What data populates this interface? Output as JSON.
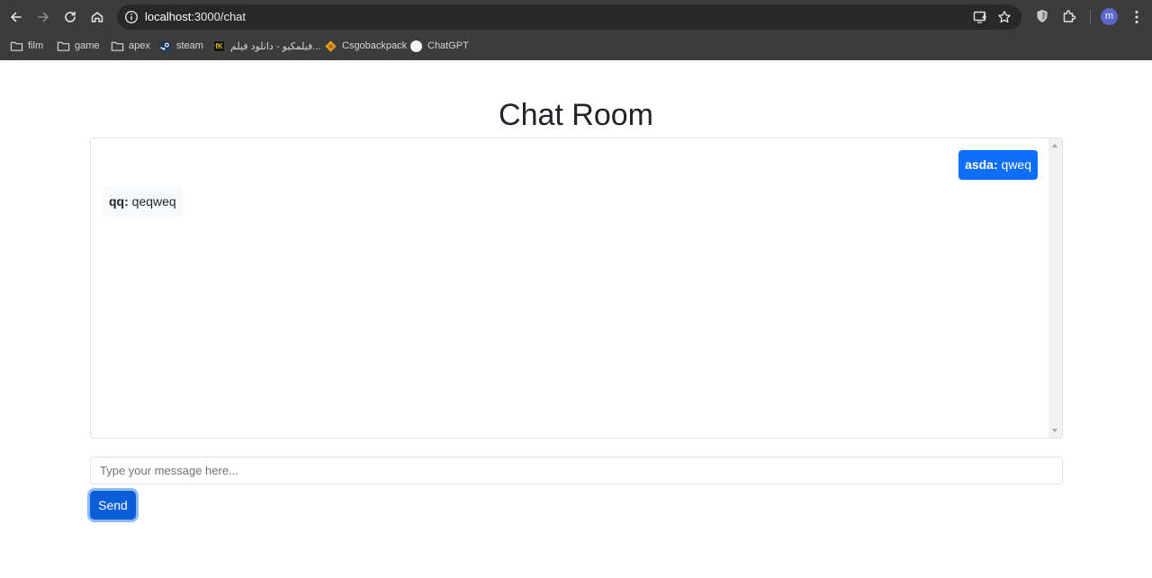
{
  "browser": {
    "url_host": "localhost",
    "url_path": ":3000/chat",
    "profile_initial": "m",
    "bookmarks": [
      {
        "label": "film",
        "icon": "folder-icon"
      },
      {
        "label": "game",
        "icon": "folder-icon"
      },
      {
        "label": "apex",
        "icon": "folder-icon"
      },
      {
        "label": "steam",
        "icon": "steam-icon"
      },
      {
        "label": "فیلمکیو - دانلود فیلم...",
        "icon": "filmkio-icon"
      },
      {
        "label": "Csgobackpack",
        "icon": "csgobackpack-icon"
      },
      {
        "label": "ChatGPT",
        "icon": "chatgpt-icon"
      }
    ]
  },
  "page": {
    "title": "Chat Room"
  },
  "chat": {
    "messages": [
      {
        "sender": "asda:",
        "text": "qweq",
        "own": true
      },
      {
        "sender": "qq:",
        "text": "qeqweq",
        "own": false
      }
    ]
  },
  "composer": {
    "placeholder": "Type your message here...",
    "value": "",
    "send_label": "Send"
  },
  "colors": {
    "primary": "#0d6efd",
    "send_button": "#0b5ed7",
    "incoming_bubble": "#f8f9fa",
    "chrome_bg": "#3c3c3c"
  }
}
